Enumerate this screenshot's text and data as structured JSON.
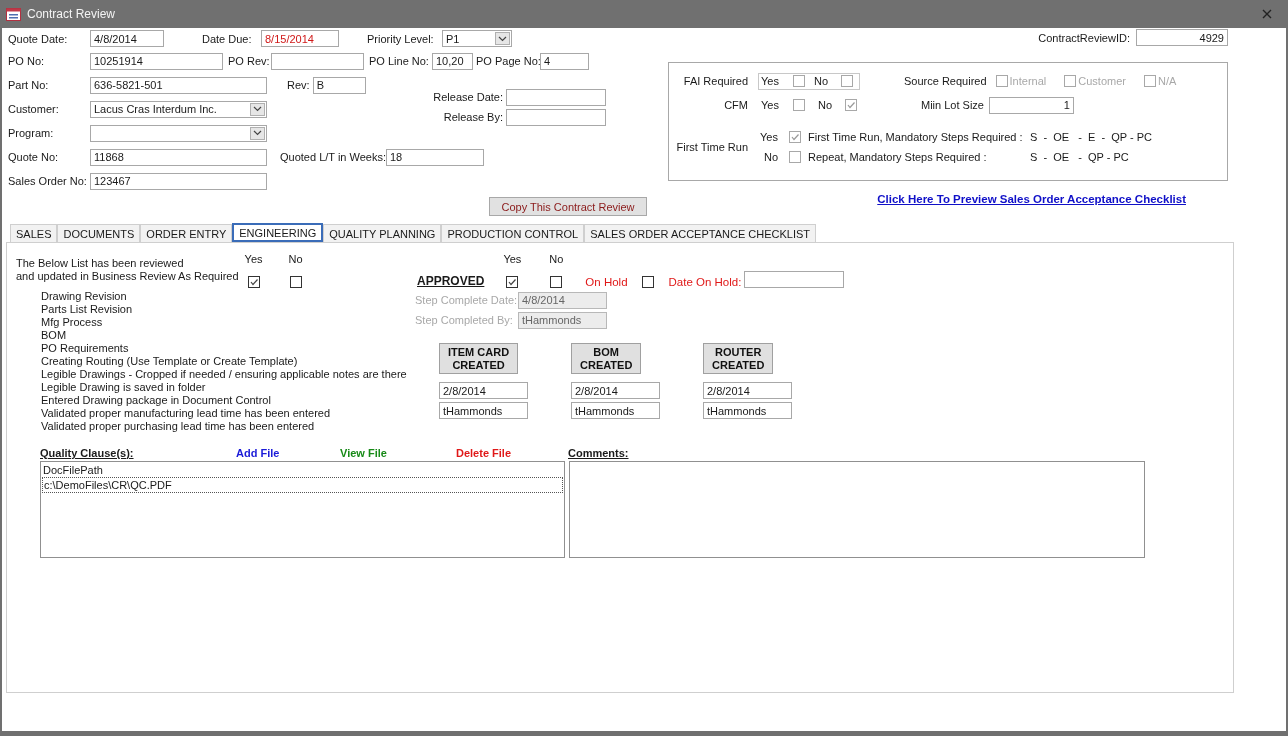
{
  "window": {
    "title": "Contract Review"
  },
  "fields": {
    "quote_date": {
      "label": "Quote Date:",
      "value": "4/8/2014"
    },
    "date_due": {
      "label": "Date Due:",
      "value": "8/15/2014",
      "overdue": true
    },
    "priority_level": {
      "label": "Priority Level:",
      "value": "P1"
    },
    "po_no": {
      "label": "PO No:",
      "value": "10251914"
    },
    "po_rev": {
      "label": "PO Rev:"
    },
    "po_line_no": {
      "label": "PO Line No:",
      "value": "10,20"
    },
    "po_page_no": {
      "label": "PO Page No:",
      "value": "4"
    },
    "part_no": {
      "label": "Part No:",
      "value": "636-5821-501"
    },
    "rev": {
      "label": "Rev:",
      "value": "B"
    },
    "customer": {
      "label": "Customer:",
      "value": "Lacus Cras Interdum Inc."
    },
    "program": {
      "label": "Program:"
    },
    "release_date": {
      "label": "Release Date:"
    },
    "release_by": {
      "label": "Release By:"
    },
    "quote_no": {
      "label": "Quote No:",
      "value": "11868"
    },
    "quoted_lt_weeks": {
      "label": "Quoted L/T in Weeks:",
      "value": "18"
    },
    "sales_order_no": {
      "label": "Sales Order No:",
      "value": "123467"
    },
    "contract_review_id": {
      "label": "ContractReviewID:",
      "value": "4929"
    }
  },
  "copy_button": "Copy This Contract Review",
  "requirements": {
    "fai": {
      "label": "FAI Required",
      "options": [
        {
          "label": "Yes",
          "checked": false
        },
        {
          "label": "No",
          "checked": false
        }
      ]
    },
    "source": {
      "label": "Source Required",
      "options": [
        {
          "label": "Internal",
          "checked": false,
          "disabled": true
        },
        {
          "label": "Customer",
          "checked": false,
          "disabled": true
        },
        {
          "label": "N/A",
          "checked": false,
          "disabled": true
        }
      ]
    },
    "cfm": {
      "label": "CFM",
      "options": [
        {
          "label": "Yes",
          "checked": false
        },
        {
          "label": "No",
          "checked": true
        }
      ]
    },
    "min_lot_size": {
      "label": "Miin Lot Size",
      "value": "1"
    },
    "first_time_run": {
      "label": "First Time Run",
      "options": [
        {
          "label": "Yes",
          "checked": true,
          "description": "First Time Run, Mandatory Steps Required :",
          "steps": "S  -  OE   -  E  -  QP - PC"
        },
        {
          "label": "No",
          "checked": false,
          "description": "Repeat, Mandatory Steps Required :",
          "steps": "S  -  OE   -  QP - PC"
        }
      ]
    }
  },
  "preview_link": "Click Here To Preview Sales Order Acceptance Checklist",
  "tabs": [
    {
      "label": "SALES",
      "selected": false
    },
    {
      "label": "DOCUMENTS",
      "selected": false
    },
    {
      "label": "ORDER ENTRY",
      "selected": false
    },
    {
      "label": "ENGINEERING",
      "selected": true
    },
    {
      "label": "QUALITY PLANNING",
      "selected": false
    },
    {
      "label": "PRODUCTION CONTROL",
      "selected": false
    },
    {
      "label": "SALES ORDER ACCEPTANCE CHECKLIST",
      "selected": false
    }
  ],
  "engineering": {
    "review": {
      "text": "The Below List has been reviewed\nand updated in Business Review As Required",
      "options": [
        {
          "label": "Yes",
          "checked": true
        },
        {
          "label": "No",
          "checked": false
        }
      ]
    },
    "checklist": [
      "Drawing Revision",
      "Parts List Revision",
      "Mfg Process",
      "BOM",
      "PO Requirements",
      "Creating Routing (Use Template or Create Template)",
      "Legible Drawings - Cropped if needed / ensuring applicable notes are there",
      "Legible Drawing is saved in folder",
      "Entered Drawing package in Document Control",
      "Validated proper manufacturing lead time has been entered",
      "Validated proper purchasing lead time has been entered"
    ],
    "approval": {
      "label": "APPROVED",
      "options": [
        {
          "label": "Yes",
          "checked": true
        },
        {
          "label": "No",
          "checked": false
        }
      ],
      "on_hold": {
        "label": "On Hold",
        "checked": false
      },
      "date_on_hold": {
        "label": "Date On Hold:"
      }
    },
    "step_complete_date": {
      "label": "Step Complete Date:",
      "value": "4/8/2014",
      "disabled": true
    },
    "step_completed_by": {
      "label": "Step Completed By:",
      "value": "tHammonds",
      "disabled": true
    },
    "created": [
      {
        "button": "ITEM CARD\nCREATED",
        "date": "2/8/2014",
        "by": "tHammonds"
      },
      {
        "button": "BOM\nCREATED",
        "date": "2/8/2014",
        "by": "tHammonds"
      },
      {
        "button": "ROUTER\nCREATED",
        "date": "2/8/2014",
        "by": "tHammonds"
      }
    ],
    "quality_clauses": {
      "label": "Quality Clause(s):",
      "actions": [
        {
          "label": "Add File",
          "color": "#1a1ad8"
        },
        {
          "label": "View File",
          "color": "#178a17"
        },
        {
          "label": "Delete File",
          "color": "#e01818"
        }
      ],
      "columns": [
        "DocFilePath"
      ],
      "rows": [
        "c:\\DemoFiles\\CR\\QC.PDF"
      ]
    },
    "comments": {
      "label": "Comments:"
    }
  }
}
